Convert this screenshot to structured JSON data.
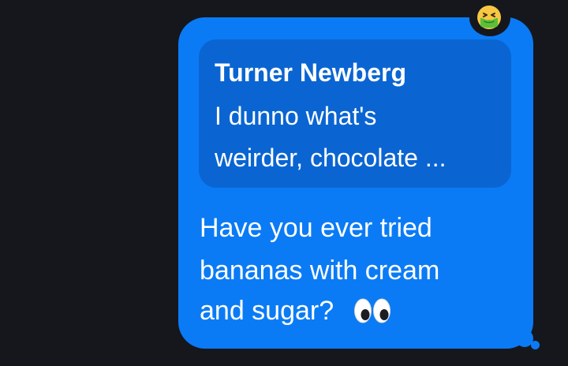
{
  "message": {
    "reply_to": {
      "author": "Turner Newberg",
      "preview_lines": [
        "I dunno what's",
        "weirder, chocolate ..."
      ]
    },
    "body_lines": [
      "Have you ever tried",
      "bananas with cream",
      "and sugar?"
    ],
    "inline_emoji": "eyes-icon",
    "reaction_emoji": "nauseated-face-icon"
  },
  "colors": {
    "background": "#16171d",
    "bubble": "#0b7bf5",
    "quote": "#0a65d2",
    "text": "#ffffff"
  }
}
